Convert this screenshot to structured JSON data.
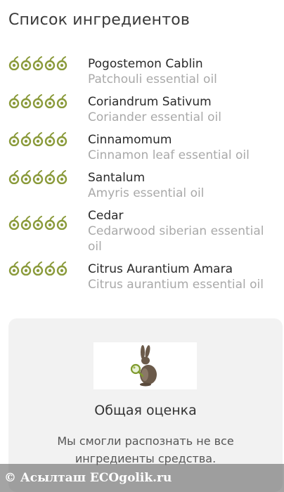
{
  "page": {
    "title": "Список ингредиентов"
  },
  "colors": {
    "rating_icon": "#8a9a3a",
    "name_text": "#2a2a2a",
    "desc_text": "#a9a9a9",
    "card_bg": "#f2f2f2"
  },
  "ingredients": [
    {
      "name": "Pogostemon Cablin",
      "description": "Patchouli essential oil",
      "rating": 5
    },
    {
      "name": "Coriandrum Sativum",
      "description": "Coriander essential oil",
      "rating": 5
    },
    {
      "name": "Cinnamomum",
      "description": "Cinnamon leaf essential oil",
      "rating": 5
    },
    {
      "name": "Santalum",
      "description": "Amyris essential oil",
      "rating": 5
    },
    {
      "name": "Cedar",
      "description": "Cedarwood siberian essential oil",
      "rating": 5
    },
    {
      "name": "Citrus Aurantium Amara",
      "description": "Citrus aurantium essential oil",
      "rating": 5
    }
  ],
  "summary_card": {
    "icon": "rabbit-magnifier-icon",
    "title": "Общая оценка",
    "text": "Мы смогли распознать не все ингредиенты средства."
  },
  "watermark": {
    "text": "© Асылташ ECOgolik.ru"
  }
}
